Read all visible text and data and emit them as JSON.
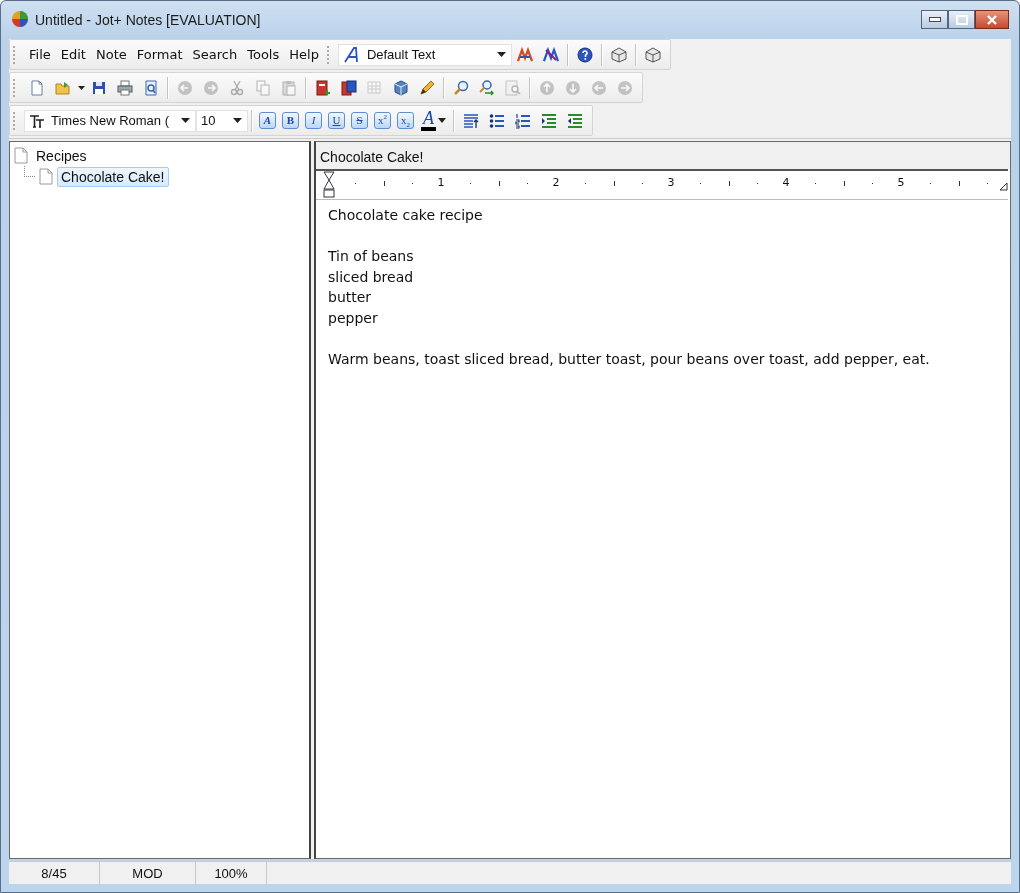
{
  "window": {
    "title": "Untitled - Jot+ Notes [EVALUATION]"
  },
  "menu": [
    "File",
    "Edit",
    "Note",
    "Format",
    "Search",
    "Tools",
    "Help"
  ],
  "style_box": {
    "value": "Default Text"
  },
  "menu_tools": [
    [
      {
        "kind": "stylered",
        "disabled": false
      },
      {
        "kind": "styleblue",
        "disabled": false
      }
    ],
    [
      {
        "kind": "help",
        "disabled": false
      }
    ],
    [
      {
        "kind": "box",
        "disabled": false
      }
    ],
    [
      {
        "kind": "box",
        "disabled": false
      }
    ]
  ],
  "toolbar": [
    [
      {
        "kind": "new",
        "disabled": false
      },
      {
        "kind": "open",
        "disabled": false
      },
      {
        "kind": "caret",
        "disabled": false
      },
      {
        "kind": "save",
        "disabled": false
      },
      {
        "kind": "print",
        "disabled": false
      },
      {
        "kind": "preview",
        "disabled": false
      }
    ],
    [
      {
        "kind": "undo",
        "disabled": true
      },
      {
        "kind": "redo",
        "disabled": true
      },
      {
        "kind": "cut",
        "disabled": true
      },
      {
        "kind": "copy",
        "disabled": true
      },
      {
        "kind": "paste",
        "disabled": true
      }
    ],
    [
      {
        "kind": "noteadd",
        "disabled": false
      },
      {
        "kind": "notechild",
        "disabled": false
      },
      {
        "kind": "grid",
        "disabled": true
      },
      {
        "kind": "cube",
        "disabled": false
      },
      {
        "kind": "pencil",
        "disabled": false
      }
    ],
    [
      {
        "kind": "find",
        "disabled": false
      },
      {
        "kind": "findreplace",
        "disabled": false
      },
      {
        "kind": "findpage",
        "disabled": true
      }
    ],
    [
      {
        "kind": "up",
        "disabled": true
      },
      {
        "kind": "down",
        "disabled": true
      },
      {
        "kind": "left",
        "disabled": true
      },
      {
        "kind": "right",
        "disabled": true
      }
    ]
  ],
  "font_box": {
    "value": "Times New Roman (",
    "size": "10"
  },
  "format_buttons": [
    {
      "label": "A",
      "kind": "style"
    },
    {
      "label": "B",
      "kind": "bold"
    },
    {
      "label": "I",
      "kind": "italic"
    },
    {
      "label": "U",
      "kind": "underline"
    },
    {
      "label": "S",
      "kind": "strike"
    },
    {
      "label": "x$^{2}$",
      "kind": "plain"
    },
    {
      "label": "x$_{2}$",
      "kind": "plain"
    }
  ],
  "font_color": {
    "label": "A",
    "color": "#000000"
  },
  "para_tools": [
    {
      "kind": "align"
    },
    {
      "kind": "bullets"
    },
    {
      "kind": "numbers"
    },
    {
      "kind": "indent"
    },
    {
      "kind": "outdent"
    }
  ],
  "tree": [
    {
      "label": "Recipes",
      "selected": false,
      "children": [
        {
          "label": "Chocolate Cake!",
          "selected": true
        }
      ]
    }
  ],
  "note": {
    "title": "Chocolate Cake!",
    "ruler": [
      "1",
      "2",
      "3",
      "4",
      "5"
    ],
    "paragraphs": [
      [
        "Chocolate cake recipe"
      ],
      [
        "Tin of beans",
        "sliced bread",
        "butter",
        "pepper"
      ],
      [
        "Warm beans, toast sliced bread, butter toast, pour beans over toast, add pepper, eat."
      ]
    ]
  },
  "status_bar": [
    "8/45",
    "MOD",
    "100%"
  ]
}
